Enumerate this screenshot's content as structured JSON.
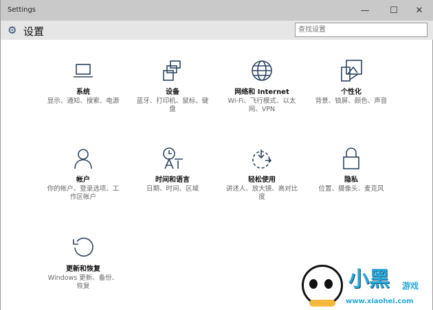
{
  "window": {
    "title": "Settings",
    "minimize": "—",
    "maximize": "☐",
    "close": "✕"
  },
  "header": {
    "title": "设置",
    "search_placeholder": "查找设置"
  },
  "tiles": [
    {
      "name": "系统",
      "desc": "显示、通知、搜索、电源",
      "icon": "laptop-icon"
    },
    {
      "name": "设备",
      "desc": "蓝牙、打印机、鼠标、键盘",
      "icon": "devices-icon"
    },
    {
      "name": "网络和 Internet",
      "desc": "Wi-Fi、飞行模式、以太网、VPN",
      "icon": "globe-icon"
    },
    {
      "name": "个性化",
      "desc": "背景、锁屏、颜色、声音",
      "icon": "personalization-icon"
    },
    {
      "name": "帐户",
      "desc": "你的帐户、登录选项、工作区帐户",
      "icon": "person-icon"
    },
    {
      "name": "时间和语言",
      "desc": "日期、时间、区域",
      "icon": "time-language-icon"
    },
    {
      "name": "轻松使用",
      "desc": "讲述人、放大镜、高对比度",
      "icon": "ease-of-access-icon"
    },
    {
      "name": "隐私",
      "desc": "位置、摄像头、麦克风",
      "icon": "lock-icon"
    },
    {
      "name": "更新和恢复",
      "desc": "Windows 更新、备份、恢复",
      "icon": "refresh-icon"
    }
  ],
  "watermark": {
    "logo": "小黑",
    "sub": "游戏",
    "url": "www.xiaohei.com"
  }
}
